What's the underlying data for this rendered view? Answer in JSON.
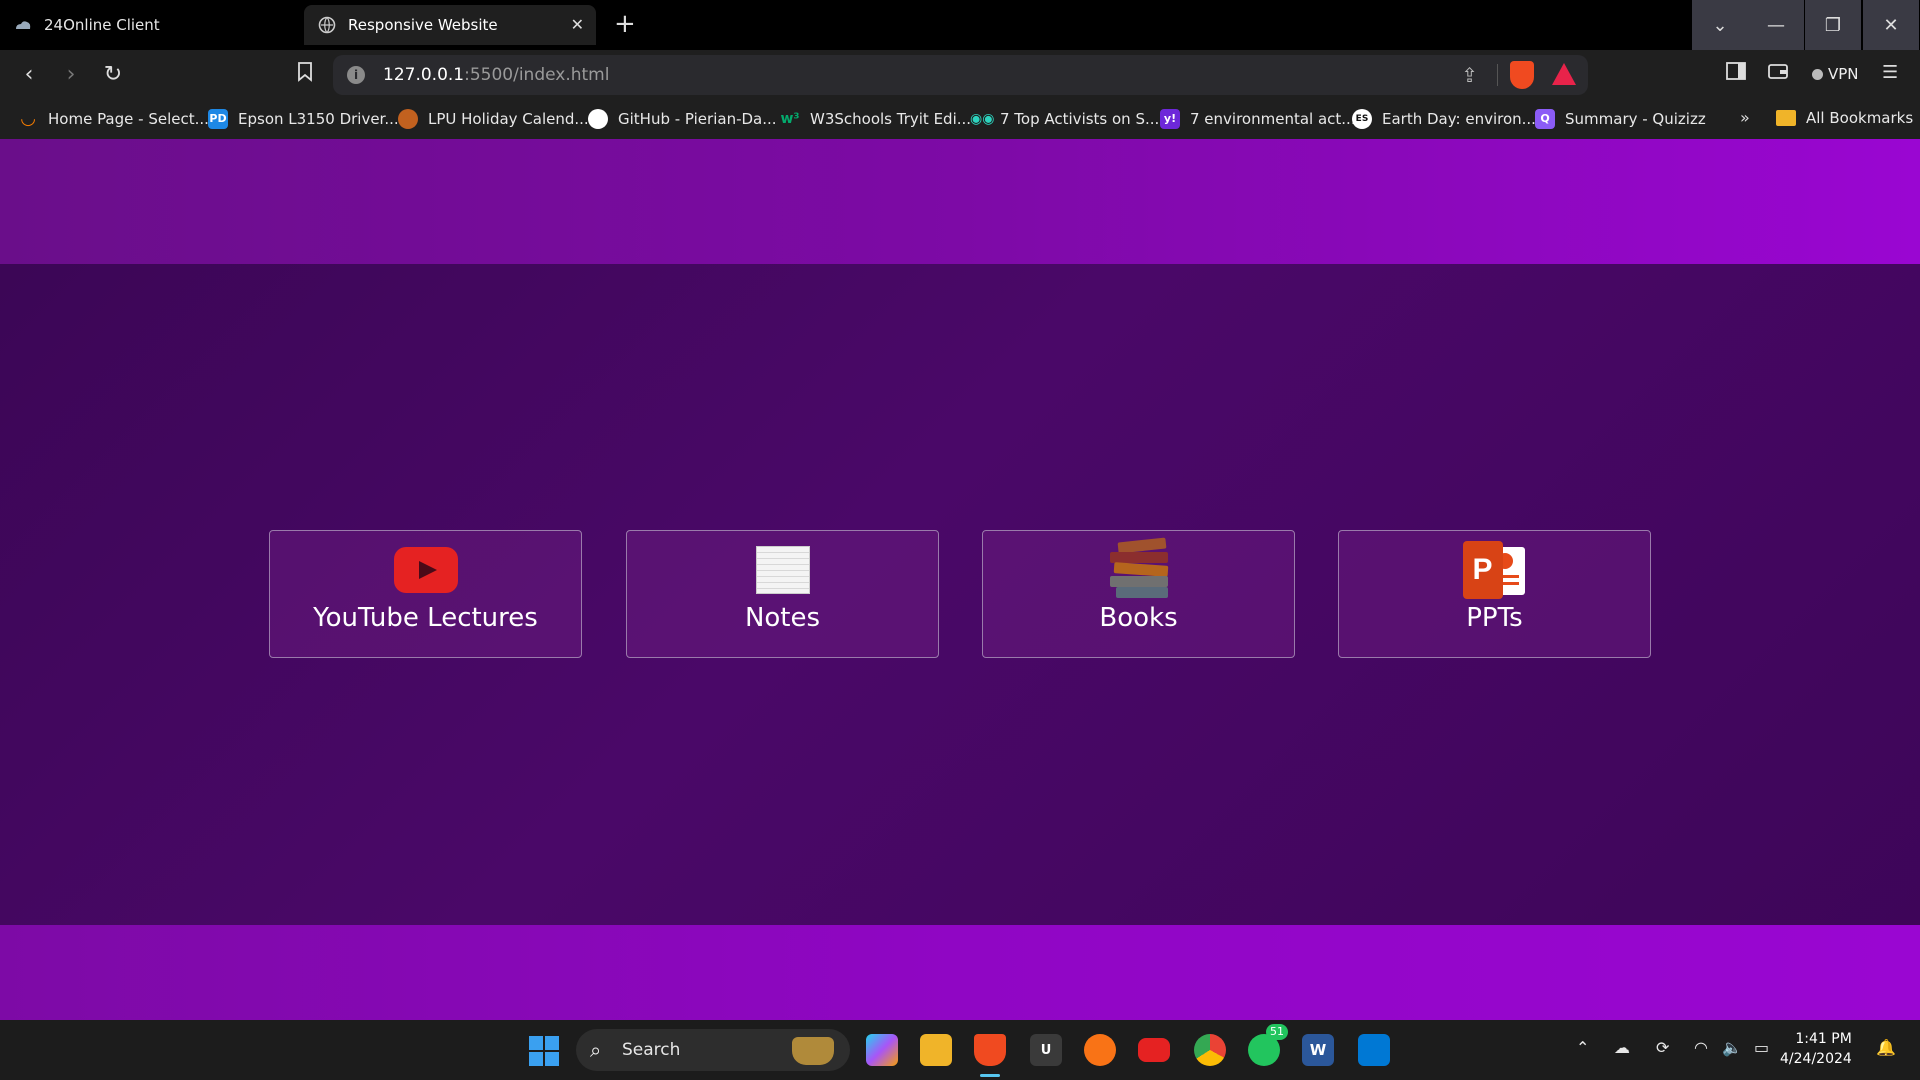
{
  "browser": {
    "tabs": [
      {
        "title": "24Online Client",
        "active": false
      },
      {
        "title": "Responsive Website",
        "active": true
      }
    ],
    "new_tab": "+",
    "url_host": "127.0.0.1",
    "url_rest": ":5500/index.html",
    "vpn_label": "VPN",
    "bookmarks": [
      {
        "label": "Home Page - Select...",
        "icon_color": "#f57c00"
      },
      {
        "label": "Epson L3150 Driver...",
        "icon_color": "#1e88e5"
      },
      {
        "label": "LPU Holiday Calend...",
        "icon_color": "#e67e22"
      },
      {
        "label": "GitHub - Pierian-Da...",
        "icon_color": "#ffffff"
      },
      {
        "label": "W3Schools Tryit Edi...",
        "icon_color": "#04aa6d"
      },
      {
        "label": "7 Top Activists on S...",
        "icon_color": "#2dd4bf"
      },
      {
        "label": "7 environmental act...",
        "icon_color": "#6d28d9"
      },
      {
        "label": "Earth Day: environ...",
        "icon_color": "#ffffff"
      },
      {
        "label": "Summary - Quizizz",
        "icon_color": "#8b5cf6"
      }
    ],
    "bookmarks_overflow": "»",
    "all_bookmarks": "All Bookmarks"
  },
  "page": {
    "cards": [
      {
        "label": "YouTube Lectures",
        "icon": "youtube-icon"
      },
      {
        "label": "Notes",
        "icon": "notes-icon"
      },
      {
        "label": "Books",
        "icon": "books-icon"
      },
      {
        "label": "PPTs",
        "icon": "powerpoint-icon"
      }
    ],
    "colors": {
      "header": "#7d0aa6",
      "body": "#45086a",
      "footer": "#9006c4",
      "card_border": "#9a7aab"
    }
  },
  "taskbar": {
    "search_label": "Search",
    "whatsapp_badge": "51",
    "time": "1:41 PM",
    "date": "4/24/2024"
  }
}
